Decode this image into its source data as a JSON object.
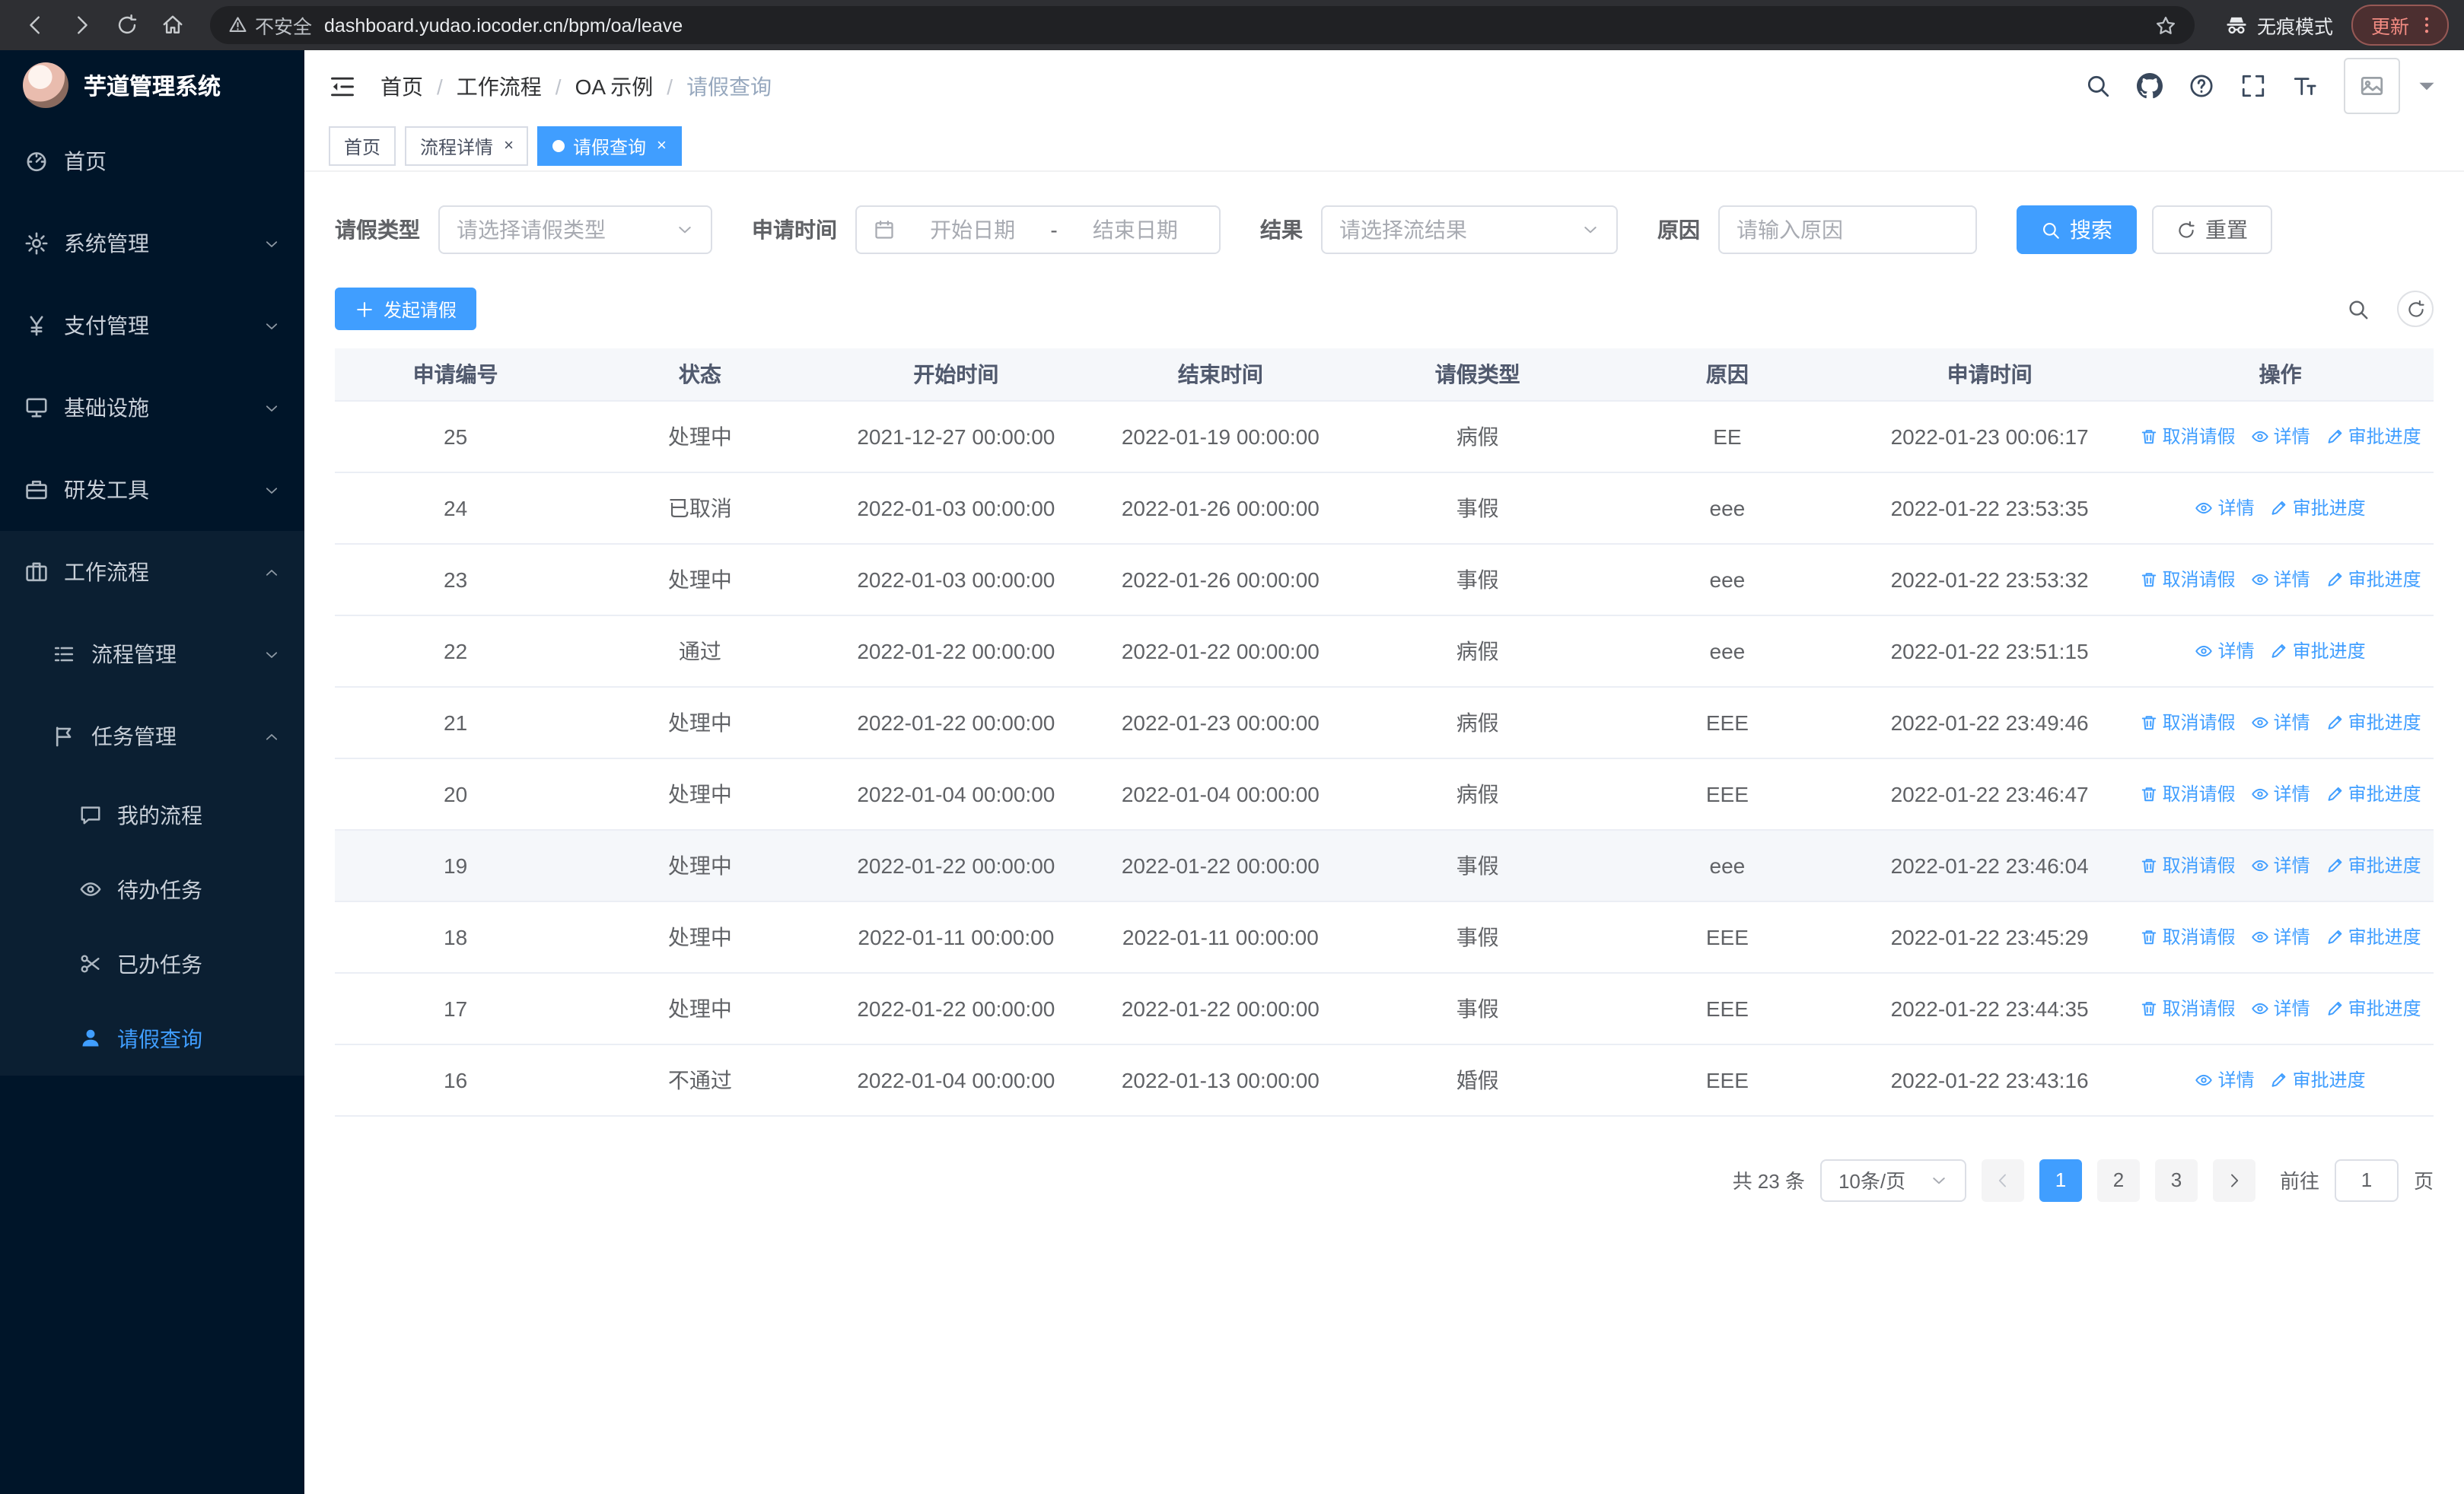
{
  "browser": {
    "security_warning": "不安全",
    "url": "dashboard.yudao.iocoder.cn/bpm/oa/leave",
    "incognito_label": "无痕模式",
    "update_label": "更新"
  },
  "app": {
    "title": "芋道管理系统"
  },
  "sidebar": {
    "menu": [
      {
        "label": "首页",
        "icon": "dashboard-icon",
        "chevron": null
      },
      {
        "label": "系统管理",
        "icon": "gear-icon",
        "chevron": "down"
      },
      {
        "label": "支付管理",
        "icon": "payment-icon",
        "chevron": "down"
      },
      {
        "label": "基础设施",
        "icon": "infrastructure-icon",
        "chevron": "down"
      },
      {
        "label": "研发工具",
        "icon": "devtools-icon",
        "chevron": "down"
      }
    ],
    "workflow_section": {
      "label": "工作流程",
      "icon": "workflow-icon",
      "chevron": "up",
      "children": [
        {
          "label": "流程管理",
          "icon": "process-icon",
          "chevron": "down",
          "children": []
        },
        {
          "label": "任务管理",
          "icon": "task-icon",
          "chevron": "up",
          "children": [
            {
              "label": "我的流程",
              "icon": "my-process-icon",
              "active": false
            },
            {
              "label": "待办任务",
              "icon": "todo-icon",
              "active": false
            },
            {
              "label": "已办任务",
              "icon": "done-icon",
              "active": false
            },
            {
              "label": "请假查询",
              "icon": "user-icon",
              "active": true
            }
          ]
        }
      ]
    }
  },
  "header": {
    "breadcrumb": [
      "首页",
      "工作流程",
      "OA 示例",
      "请假查询"
    ]
  },
  "tabs": [
    {
      "label": "首页",
      "closable": false,
      "active": false
    },
    {
      "label": "流程详情",
      "closable": true,
      "active": false
    },
    {
      "label": "请假查询",
      "closable": true,
      "active": true
    }
  ],
  "filters": {
    "leave_type_label": "请假类型",
    "leave_type_placeholder": "请选择请假类型",
    "apply_time_label": "申请时间",
    "start_date_placeholder": "开始日期",
    "date_separator": "-",
    "end_date_placeholder": "结束日期",
    "result_label": "结果",
    "result_placeholder": "请选择流结果",
    "reason_label": "原因",
    "reason_placeholder": "请输入原因",
    "search_button": "搜索",
    "reset_button": "重置"
  },
  "toolbar": {
    "create_button": "发起请假"
  },
  "table": {
    "columns": [
      "申请编号",
      "状态",
      "开始时间",
      "结束时间",
      "请假类型",
      "原因",
      "申请时间",
      "操作"
    ],
    "action_labels": {
      "cancel": "取消请假",
      "detail": "详情",
      "progress": "审批进度"
    },
    "rows": [
      {
        "id": "25",
        "status": "处理中",
        "start": "2021-12-27 00:00:00",
        "end": "2022-01-19 00:00:00",
        "type": "病假",
        "reason": "EE",
        "applied": "2022-01-23 00:06:17",
        "actions": [
          "cancel",
          "detail",
          "progress"
        ],
        "highlight": false
      },
      {
        "id": "24",
        "status": "已取消",
        "start": "2022-01-03 00:00:00",
        "end": "2022-01-26 00:00:00",
        "type": "事假",
        "reason": "eee",
        "applied": "2022-01-22 23:53:35",
        "actions": [
          "detail",
          "progress"
        ],
        "highlight": false
      },
      {
        "id": "23",
        "status": "处理中",
        "start": "2022-01-03 00:00:00",
        "end": "2022-01-26 00:00:00",
        "type": "事假",
        "reason": "eee",
        "applied": "2022-01-22 23:53:32",
        "actions": [
          "cancel",
          "detail",
          "progress"
        ],
        "highlight": false
      },
      {
        "id": "22",
        "status": "通过",
        "start": "2022-01-22 00:00:00",
        "end": "2022-01-22 00:00:00",
        "type": "病假",
        "reason": "eee",
        "applied": "2022-01-22 23:51:15",
        "actions": [
          "detail",
          "progress"
        ],
        "highlight": false
      },
      {
        "id": "21",
        "status": "处理中",
        "start": "2022-01-22 00:00:00",
        "end": "2022-01-23 00:00:00",
        "type": "病假",
        "reason": "EEE",
        "applied": "2022-01-22 23:49:46",
        "actions": [
          "cancel",
          "detail",
          "progress"
        ],
        "highlight": false
      },
      {
        "id": "20",
        "status": "处理中",
        "start": "2022-01-04 00:00:00",
        "end": "2022-01-04 00:00:00",
        "type": "病假",
        "reason": "EEE",
        "applied": "2022-01-22 23:46:47",
        "actions": [
          "cancel",
          "detail",
          "progress"
        ],
        "highlight": false
      },
      {
        "id": "19",
        "status": "处理中",
        "start": "2022-01-22 00:00:00",
        "end": "2022-01-22 00:00:00",
        "type": "事假",
        "reason": "eee",
        "applied": "2022-01-22 23:46:04",
        "actions": [
          "cancel",
          "detail",
          "progress"
        ],
        "highlight": true
      },
      {
        "id": "18",
        "status": "处理中",
        "start": "2022-01-11 00:00:00",
        "end": "2022-01-11 00:00:00",
        "type": "事假",
        "reason": "EEE",
        "applied": "2022-01-22 23:45:29",
        "actions": [
          "cancel",
          "detail",
          "progress"
        ],
        "highlight": false
      },
      {
        "id": "17",
        "status": "处理中",
        "start": "2022-01-22 00:00:00",
        "end": "2022-01-22 00:00:00",
        "type": "事假",
        "reason": "EEE",
        "applied": "2022-01-22 23:44:35",
        "actions": [
          "cancel",
          "detail",
          "progress"
        ],
        "highlight": false
      },
      {
        "id": "16",
        "status": "不通过",
        "start": "2022-01-04 00:00:00",
        "end": "2022-01-13 00:00:00",
        "type": "婚假",
        "reason": "EEE",
        "applied": "2022-01-22 23:43:16",
        "actions": [
          "detail",
          "progress"
        ],
        "highlight": false
      }
    ]
  },
  "pagination": {
    "total_text": "共 23 条",
    "page_size": "10条/页",
    "pages": [
      "1",
      "2",
      "3"
    ],
    "current_page": "1",
    "goto_label": "前往",
    "goto_value": "1",
    "goto_suffix": "页"
  },
  "colors": {
    "primary": "#409eff",
    "sidebar_bg": "#001529"
  }
}
